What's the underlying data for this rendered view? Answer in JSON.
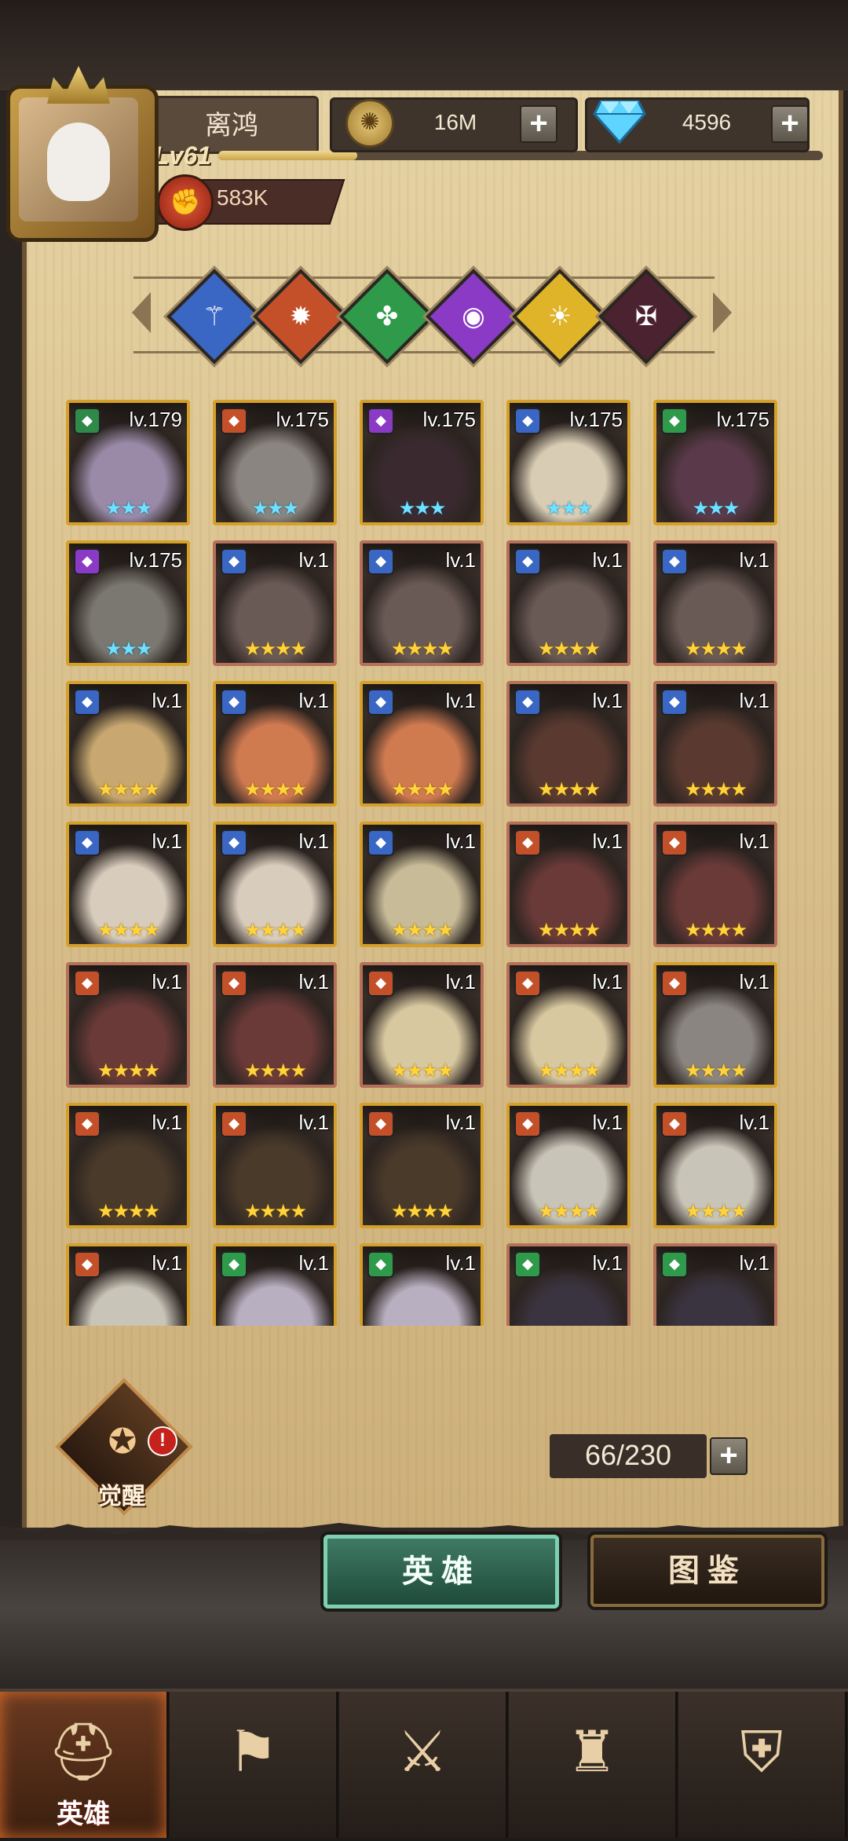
{
  "player": {
    "name": "离鸿",
    "level_label": "Lv61",
    "exp_fraction": 0.23,
    "power": "583K"
  },
  "currency": {
    "gold": "16M",
    "gems": "4596",
    "plus_symbol": "+"
  },
  "filters": [
    {
      "name": "filter-faction-blue-icon",
      "color": "#3a66c4",
      "glyph": "⚚"
    },
    {
      "name": "filter-faction-red-icon",
      "color": "#c4502a",
      "glyph": "✹"
    },
    {
      "name": "filter-faction-green-icon",
      "color": "#2f9a4a",
      "glyph": "✤"
    },
    {
      "name": "filter-faction-purple-icon",
      "color": "#8a3ac4",
      "glyph": "◉"
    },
    {
      "name": "filter-faction-gold-icon",
      "color": "#e0b428",
      "glyph": "☀"
    },
    {
      "name": "filter-faction-dark-icon",
      "color": "#4a2230",
      "glyph": "✠"
    }
  ],
  "heroes": [
    {
      "level": "lv.179",
      "stars": "★★★",
      "star_color": "blue",
      "frame": "gold",
      "class_color": "#2f8a4a",
      "skin": "#9a8aa8"
    },
    {
      "level": "lv.175",
      "stars": "★★★",
      "star_color": "blue",
      "frame": "gold",
      "class_color": "#c4502a",
      "skin": "#8a8580"
    },
    {
      "level": "lv.175",
      "stars": "★★★",
      "star_color": "blue",
      "frame": "gold",
      "class_color": "#8a3ac4",
      "skin": "#3a2a30"
    },
    {
      "level": "lv.175",
      "stars": "★★★",
      "star_color": "blue",
      "frame": "gold",
      "class_color": "#3a66c4",
      "skin": "#d8ccb4"
    },
    {
      "level": "lv.175",
      "stars": "★★★",
      "star_color": "blue",
      "frame": "gold",
      "class_color": "#2f9a4a",
      "skin": "#5a3a4a"
    },
    {
      "level": "lv.175",
      "stars": "★★★",
      "star_color": "blue",
      "frame": "gold",
      "class_color": "#8a3ac4",
      "skin": "#7a7870"
    },
    {
      "level": "lv.1",
      "stars": "★★★★",
      "star_color": "gold",
      "frame": "red",
      "class_color": "#3a66c4",
      "skin": "#6a5a55"
    },
    {
      "level": "lv.1",
      "stars": "★★★★",
      "star_color": "gold",
      "frame": "red",
      "class_color": "#3a66c4",
      "skin": "#6a5a55"
    },
    {
      "level": "lv.1",
      "stars": "★★★★",
      "star_color": "gold",
      "frame": "red",
      "class_color": "#3a66c4",
      "skin": "#6a5a55"
    },
    {
      "level": "lv.1",
      "stars": "★★★★",
      "star_color": "gold",
      "frame": "red",
      "class_color": "#3a66c4",
      "skin": "#6a5a55"
    },
    {
      "level": "lv.1",
      "stars": "★★★★",
      "star_color": "gold",
      "frame": "gold",
      "class_color": "#3a66c4",
      "skin": "#c8a870"
    },
    {
      "level": "lv.1",
      "stars": "★★★★",
      "star_color": "gold",
      "frame": "gold",
      "class_color": "#3a66c4",
      "skin": "#d07a50"
    },
    {
      "level": "lv.1",
      "stars": "★★★★",
      "star_color": "gold",
      "frame": "gold",
      "class_color": "#3a66c4",
      "skin": "#d07a50"
    },
    {
      "level": "lv.1",
      "stars": "★★★★",
      "star_color": "gold",
      "frame": "red",
      "class_color": "#3a66c4",
      "skin": "#5a3a30"
    },
    {
      "level": "lv.1",
      "stars": "★★★★",
      "star_color": "gold",
      "frame": "red",
      "class_color": "#3a66c4",
      "skin": "#5a3a30"
    },
    {
      "level": "lv.1",
      "stars": "★★★★",
      "star_color": "gold",
      "frame": "gold",
      "class_color": "#3a66c4",
      "skin": "#d8ccbc"
    },
    {
      "level": "lv.1",
      "stars": "★★★★",
      "star_color": "gold",
      "frame": "gold",
      "class_color": "#3a66c4",
      "skin": "#d8ccbc"
    },
    {
      "level": "lv.1",
      "stars": "★★★★",
      "star_color": "gold",
      "frame": "gold",
      "class_color": "#3a66c4",
      "skin": "#c8bc98"
    },
    {
      "level": "lv.1",
      "stars": "★★★★",
      "star_color": "gold",
      "frame": "red",
      "class_color": "#c4502a",
      "skin": "#6a3a38"
    },
    {
      "level": "lv.1",
      "stars": "★★★★",
      "star_color": "gold",
      "frame": "red",
      "class_color": "#c4502a",
      "skin": "#6a3a38"
    },
    {
      "level": "lv.1",
      "stars": "★★★★",
      "star_color": "gold",
      "frame": "red",
      "class_color": "#c4502a",
      "skin": "#6a3a38"
    },
    {
      "level": "lv.1",
      "stars": "★★★★",
      "star_color": "gold",
      "frame": "red",
      "class_color": "#c4502a",
      "skin": "#6a3a38"
    },
    {
      "level": "lv.1",
      "stars": "★★★★",
      "star_color": "gold",
      "frame": "red",
      "class_color": "#c4502a",
      "skin": "#d8c8a0"
    },
    {
      "level": "lv.1",
      "stars": "★★★★",
      "star_color": "gold",
      "frame": "red",
      "class_color": "#c4502a",
      "skin": "#d8c8a0"
    },
    {
      "level": "lv.1",
      "stars": "★★★★",
      "star_color": "gold",
      "frame": "gold",
      "class_color": "#c4502a",
      "skin": "#8a8580"
    },
    {
      "level": "lv.1",
      "stars": "★★★★",
      "star_color": "gold",
      "frame": "gold",
      "class_color": "#c4502a",
      "skin": "#4a3a2a"
    },
    {
      "level": "lv.1",
      "stars": "★★★★",
      "star_color": "gold",
      "frame": "gold",
      "class_color": "#c4502a",
      "skin": "#4a3a2a"
    },
    {
      "level": "lv.1",
      "stars": "★★★★",
      "star_color": "gold",
      "frame": "gold",
      "class_color": "#c4502a",
      "skin": "#4a3a2a"
    },
    {
      "level": "lv.1",
      "stars": "★★★★",
      "star_color": "gold",
      "frame": "gold",
      "class_color": "#c4502a",
      "skin": "#c8c4b8"
    },
    {
      "level": "lv.1",
      "stars": "★★★★",
      "star_color": "gold",
      "frame": "gold",
      "class_color": "#c4502a",
      "skin": "#c8c4b8"
    },
    {
      "level": "lv.1",
      "stars": "",
      "star_color": "gold",
      "frame": "gold",
      "class_color": "#c4502a",
      "skin": "#c8c4b8"
    },
    {
      "level": "lv.1",
      "stars": "",
      "star_color": "gold",
      "frame": "gold",
      "class_color": "#2f9a4a",
      "skin": "#b8b0c0"
    },
    {
      "level": "lv.1",
      "stars": "",
      "star_color": "gold",
      "frame": "gold",
      "class_color": "#2f9a4a",
      "skin": "#b8b0c0"
    },
    {
      "level": "lv.1",
      "stars": "",
      "star_color": "gold",
      "frame": "red",
      "class_color": "#2f9a4a",
      "skin": "#3a3440"
    },
    {
      "level": "lv.1",
      "stars": "",
      "star_color": "gold",
      "frame": "red",
      "class_color": "#2f9a4a",
      "skin": "#3a3440"
    }
  ],
  "awaken": {
    "label": "觉醒",
    "alert": "!"
  },
  "roster": {
    "count": "66/230"
  },
  "tabs": {
    "heroes": "英雄",
    "codex": "图鉴"
  },
  "nav": [
    {
      "name": "nav-heroes",
      "label": "英雄",
      "glyph": "⛑",
      "active": true
    },
    {
      "name": "nav-adventure",
      "label": "",
      "glyph": "⚑",
      "active": false
    },
    {
      "name": "nav-battle",
      "label": "",
      "glyph": "⚔",
      "active": false
    },
    {
      "name": "nav-castle",
      "label": "",
      "glyph": "♜",
      "active": false
    },
    {
      "name": "nav-guild",
      "label": "",
      "glyph": "⛨",
      "active": false
    }
  ]
}
